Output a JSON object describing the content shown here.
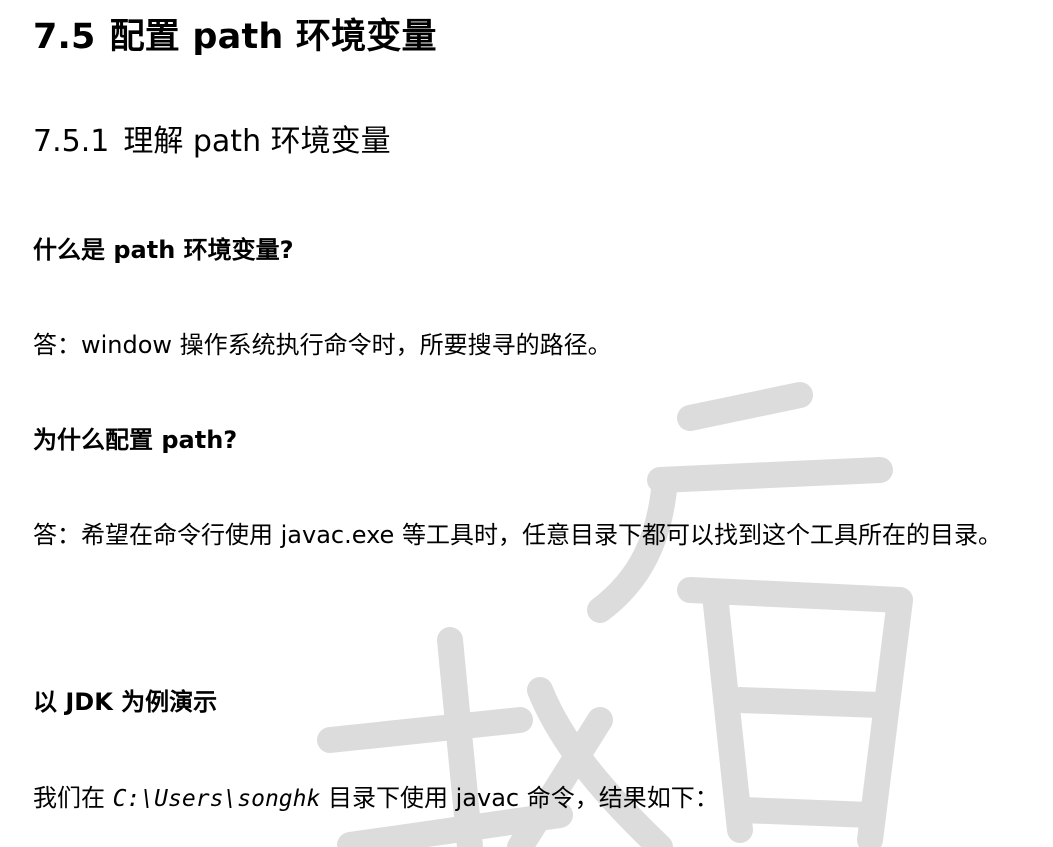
{
  "section": {
    "number": "7.5",
    "title": "配置 path 环境变量"
  },
  "subsection": {
    "number": "7.5.1",
    "title": "理解 path 环境变量"
  },
  "blocks": [
    {
      "question": "什么是 path 环境变量?"
    },
    {
      "answer": "答：window 操作系统执行命令时，所要搜寻的路径。"
    },
    {
      "question": "为什么配置 path?"
    },
    {
      "answer": "答：希望在命令行使用 javac.exe 等工具时，任意目录下都可以找到这个工具所在的目录。"
    },
    {
      "question": "以 JDK 为例演示"
    }
  ],
  "final_line": {
    "before": "我们在 ",
    "code": "C:\\Users\\songhk",
    "after": " 目录下使用 javac 命令，结果如下："
  },
  "watermark": {
    "color": "#dcdcdc"
  }
}
